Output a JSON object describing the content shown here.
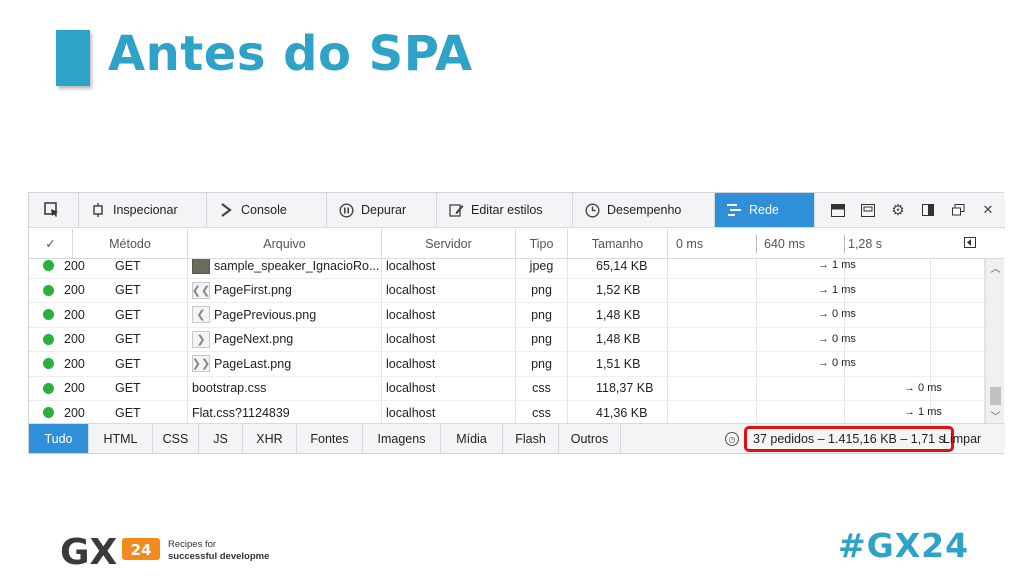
{
  "slide": {
    "title": "Antes do SPA",
    "hashtag": "#GX24",
    "logo": {
      "mark": "GX",
      "badge": "24",
      "tagline_line1": "Recipes for",
      "tagline_line2": "successful development"
    }
  },
  "toolbar": {
    "tabs": [
      {
        "label": "Inspecionar",
        "icon": "inspect-icon"
      },
      {
        "label": "Console",
        "icon": "console-icon"
      },
      {
        "label": "Depurar",
        "icon": "pause-icon"
      },
      {
        "label": "Editar estilos",
        "icon": "edit-styles-icon"
      },
      {
        "label": "Desempenho",
        "icon": "clock-icon"
      },
      {
        "label": "Rede",
        "icon": "network-icon",
        "active": true
      }
    ]
  },
  "columns": {
    "check": "✓",
    "method": "Método",
    "file": "Arquivo",
    "server": "Servidor",
    "type": "Tipo",
    "size": "Tamanho",
    "t0": "0 ms",
    "t1": "640 ms",
    "t2": "1,28 s"
  },
  "rows": [
    {
      "status": "200",
      "method": "GET",
      "file": "sample_speaker_IgnacioRo...",
      "server": "localhost",
      "type": "jpeg",
      "size": "65,14 KB",
      "time": "→ 1 ms",
      "icon": "image"
    },
    {
      "status": "200",
      "method": "GET",
      "file": "PageFirst.png",
      "server": "localhost",
      "type": "png",
      "size": "1,52 KB",
      "time": "→ 1 ms",
      "icon": "first"
    },
    {
      "status": "200",
      "method": "GET",
      "file": "PagePrevious.png",
      "server": "localhost",
      "type": "png",
      "size": "1,48 KB",
      "time": "→ 0 ms",
      "icon": "previous"
    },
    {
      "status": "200",
      "method": "GET",
      "file": "PageNext.png",
      "server": "localhost",
      "type": "png",
      "size": "1,48 KB",
      "time": "→ 0 ms",
      "icon": "next"
    },
    {
      "status": "200",
      "method": "GET",
      "file": "PageLast.png",
      "server": "localhost",
      "type": "png",
      "size": "1,51 KB",
      "time": "→ 0 ms",
      "icon": "last"
    },
    {
      "status": "200",
      "method": "GET",
      "file": "bootstrap.css",
      "server": "localhost",
      "type": "css",
      "size": "118,37 KB",
      "time": "→ 0 ms",
      "icon": "none"
    },
    {
      "status": "200",
      "method": "GET",
      "file": "Flat.css?1124839",
      "server": "localhost",
      "type": "css",
      "size": "41,36 KB",
      "time": "→ 1 ms",
      "icon": "none"
    }
  ],
  "filters": [
    "Tudo",
    "HTML",
    "CSS",
    "JS",
    "XHR",
    "Fontes",
    "Imagens",
    "Mídia",
    "Flash",
    "Outros"
  ],
  "summary": "37 pedidos – 1.415,16 KB – 1,71 s",
  "clear_label": "Limpar",
  "colors": {
    "accent": "#2ea3c7",
    "active_tab": "#2f8fd9",
    "status_ok": "#27b23a",
    "highlight": "#e01010"
  }
}
